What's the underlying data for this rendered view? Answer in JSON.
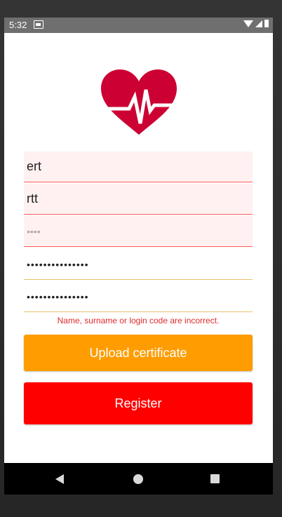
{
  "status_bar": {
    "time": "5:32",
    "icons": [
      "notification-icon",
      "wifi-icon",
      "signal-icon",
      "battery-icon"
    ]
  },
  "logo": {
    "icon": "heart-pulse-icon",
    "color": "#cc0033"
  },
  "form": {
    "name_value": "ert",
    "surname_value": "rtt",
    "login_code_placeholder": "••••",
    "password_value": "•••••••••••••••",
    "confirm_password_value": "•••••••••••••••",
    "error_message": "Name, surname or login code are incorrect."
  },
  "buttons": {
    "upload_label": "Upload certificate",
    "upload_color": "#ff9c00",
    "register_label": "Register",
    "register_color": "#ff0000"
  },
  "nav_bar": {
    "icons": [
      "back-icon",
      "home-icon",
      "recent-apps-icon"
    ]
  }
}
